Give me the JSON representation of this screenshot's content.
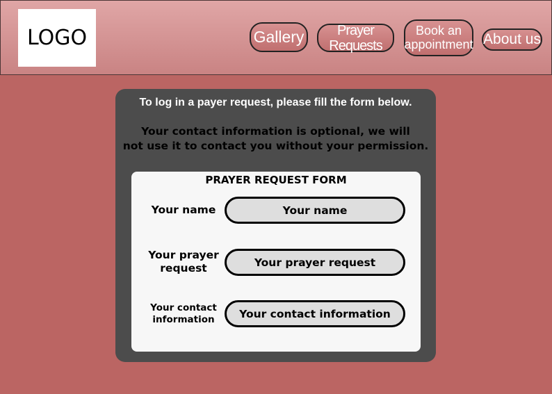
{
  "header": {
    "logo_text": "LOGO",
    "nav": {
      "gallery": "Gallery",
      "prayer_requests": "Prayer Requests",
      "book_appointment": "Book an\nappointment",
      "about_us": "About us"
    }
  },
  "panel": {
    "intro": "To log in a payer request, please fill the form below.",
    "notice": "Your contact information is optional, we will\nnot use it to contact you without your permission."
  },
  "form": {
    "title": "PRAYER REQUEST FORM",
    "fields": [
      {
        "label": "Your name",
        "placeholder": "Your name"
      },
      {
        "label": "Your prayer\nrequest",
        "placeholder": "Your prayer request"
      },
      {
        "label": "Your contact\ninformation",
        "placeholder": "Your contact information"
      }
    ]
  },
  "colors": {
    "page_background": "#bb6563",
    "header_background": "#d08e8e",
    "panel_background": "#4c4c4c",
    "form_background": "#f7f7f7",
    "input_background": "#dedede"
  }
}
